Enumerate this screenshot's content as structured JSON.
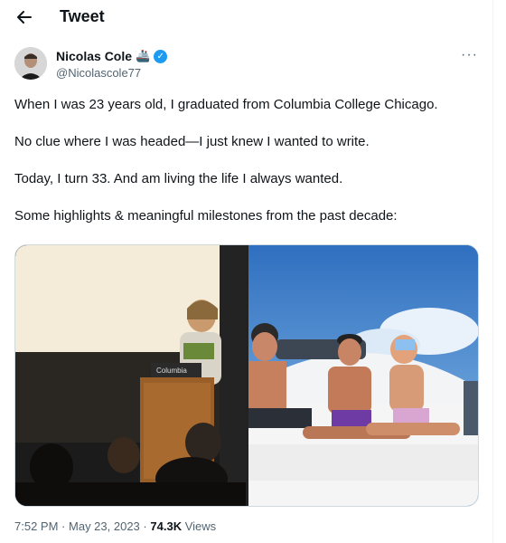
{
  "header": {
    "back_icon": "arrow-left-icon",
    "title": "Tweet"
  },
  "author": {
    "name": "Nicolas Cole",
    "emoji": "🚢",
    "verified_icon": "verified-badge-icon",
    "handle": "@Nicolascole77"
  },
  "more_icon": "more-horizontal-icon",
  "tweet": {
    "paragraphs": [
      "When I was 23 years old, I graduated from Columbia College Chicago.",
      "No clue where I was headed—I just knew I wanted to write.",
      "Today, I turn 33. And am living the life I always wanted.",
      "Some highlights & meaningful milestones from the past decade:"
    ]
  },
  "media": {
    "left_photo": {
      "podium_text": "Columbia"
    },
    "right_photo": {}
  },
  "footer": {
    "time": "7:52 PM",
    "date": "May 23, 2023",
    "views_count": "74.3K",
    "views_label": "Views",
    "separator": "·"
  },
  "colors": {
    "accent": "#1d9bf0",
    "text": "#0f1419",
    "secondary": "#536471"
  }
}
